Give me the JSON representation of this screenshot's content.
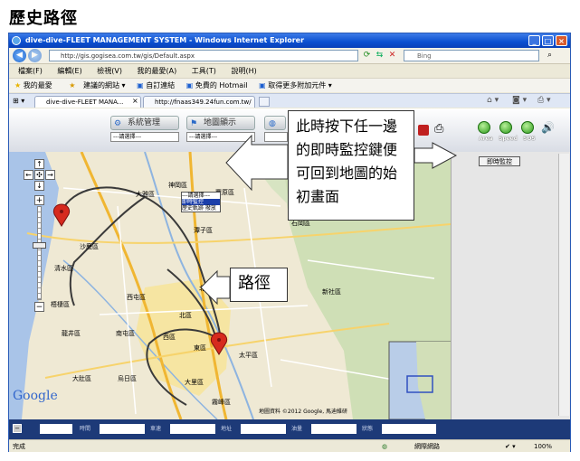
{
  "doc_title": "歷史路徑",
  "window": {
    "title": "dive-dive-FLEET MANAGEMENT SYSTEM - Windows Internet Explorer",
    "url": "http://gis.gogisea.com.tw/gis/Default.aspx",
    "search_placeholder": "Bing"
  },
  "menu": [
    "檔案(F)",
    "編輯(E)",
    "檢視(V)",
    "我的最愛(A)",
    "工具(T)",
    "說明(H)"
  ],
  "favorites": {
    "label": "我的最愛",
    "items": [
      "建議的網站 ▾",
      "自訂連結",
      "免費的 Hotmail",
      "取得更多附加元件 ▾"
    ]
  },
  "tabs": [
    "dive-dive-FLEET MANA...",
    "http://fnaas349.24fun.com.tw/"
  ],
  "app": {
    "sys_button": "系統管理",
    "map_button": "地圖顯示",
    "select_placeholder": "---請選擇---",
    "dropdown_items": [
      "---請選擇---",
      "即時監控",
      "歷史軌跡 撥放"
    ],
    "right_buttons": [
      "Area",
      "Speed",
      "SOS"
    ],
    "realtime_button": "即時監控"
  },
  "map": {
    "place_labels": [
      "大雅區",
      "神岡區",
      "豐原區",
      "潭子區",
      "沙鹿區",
      "西屯區",
      "北屯區",
      "北區",
      "西區",
      "南屯區",
      "東區",
      "烏日區",
      "大里區",
      "霧峰區",
      "太平區",
      "龍井區",
      "大肚區",
      "梧棲區",
      "清水區",
      "石岡區",
      "新社區"
    ],
    "copyright": "地圖資料 ©2012 Google, 馬迪維研"
  },
  "status_fields": [
    "時間",
    "車速",
    "地址",
    "油量",
    "狀態"
  ],
  "statusbar": {
    "left": "完成",
    "zone": "網際網路",
    "zoom": "100%"
  },
  "callouts": {
    "top": "此時按下任一邊\n的即時監控鍵便\n可回到地圖的始\n初畫面",
    "path": "路徑"
  },
  "colors": {
    "titlebar": "#0a4fd0",
    "route": "#333333",
    "pin": "#d62a1e",
    "statusfields": "#1d3a78"
  }
}
